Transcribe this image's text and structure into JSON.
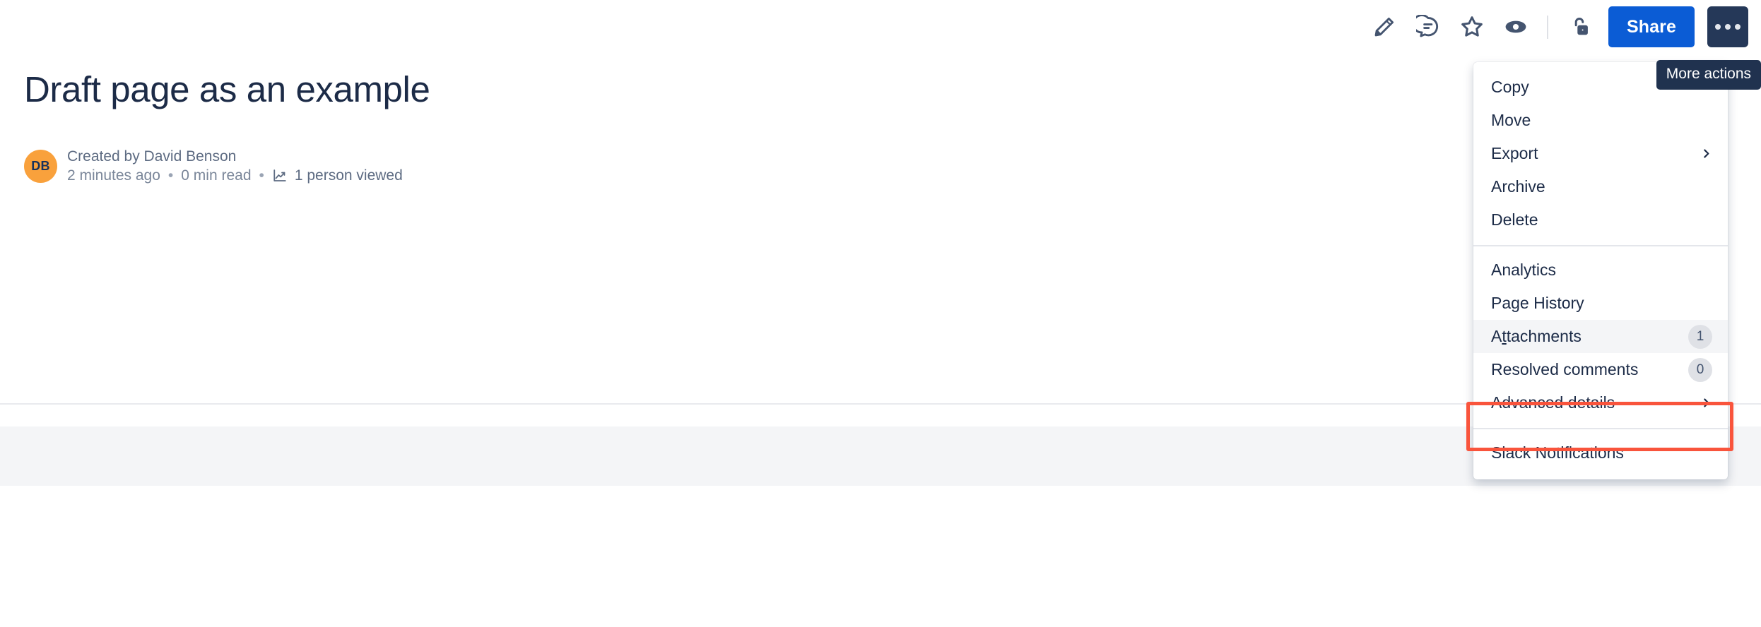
{
  "toolbar": {
    "icons": [
      {
        "name": "edit-pencil-icon",
        "label": "Edit"
      },
      {
        "name": "comment-icon",
        "label": "Comment"
      },
      {
        "name": "star-icon",
        "label": "Star"
      },
      {
        "name": "watch-eye-icon",
        "label": "Watch"
      }
    ],
    "restrictions_icon": "unlocked-padlock-icon",
    "share_label": "Share",
    "more_actions_name": "more-actions-icon",
    "tooltip": "More actions"
  },
  "page": {
    "title": "Draft page as an example",
    "avatar_initials": "DB",
    "created_by": "Created by David Benson",
    "time_ago": "2 minutes ago",
    "separator": "•",
    "read_time": "0 min read",
    "analytics_icon": "line-chart-icon",
    "views": "1 person viewed"
  },
  "menu": {
    "groups": [
      {
        "items": [
          {
            "label": "Copy",
            "name": "menu-item-copy",
            "badge": null,
            "chevron": false,
            "highlighted": false
          },
          {
            "label": "Move",
            "name": "menu-item-move",
            "badge": null,
            "chevron": false,
            "highlighted": false
          },
          {
            "label": "Export",
            "name": "menu-item-export",
            "badge": null,
            "chevron": true,
            "highlighted": false
          },
          {
            "label": "Archive",
            "name": "menu-item-archive",
            "badge": null,
            "chevron": false,
            "highlighted": false
          },
          {
            "label": "Delete",
            "name": "menu-item-delete",
            "badge": null,
            "chevron": false,
            "highlighted": false
          }
        ]
      },
      {
        "items": [
          {
            "label": "Analytics",
            "name": "menu-item-analytics",
            "badge": null,
            "chevron": false,
            "highlighted": false
          },
          {
            "label": "Page History",
            "name": "menu-item-page-history",
            "badge": null,
            "chevron": false,
            "highlighted": false
          },
          {
            "label": "Attachments",
            "name": "menu-item-attachments",
            "badge": "1",
            "chevron": false,
            "highlighted": true,
            "accesskey_index": 1
          },
          {
            "label": "Resolved comments",
            "name": "menu-item-resolved-comments",
            "badge": "0",
            "chevron": false,
            "highlighted": false
          },
          {
            "label": "Advanced details",
            "name": "menu-item-advanced-details",
            "badge": null,
            "chevron": true,
            "highlighted": false
          }
        ]
      },
      {
        "items": [
          {
            "label": "Slack Notifications",
            "name": "menu-item-slack-notifications",
            "badge": null,
            "chevron": false,
            "highlighted": false
          }
        ]
      }
    ]
  },
  "annotation": {
    "target": "Attachments",
    "color": "#F9543C"
  },
  "colors": {
    "share_blue": "#0B5CD5",
    "dark_navy": "#253858",
    "avatar_orange": "#F9A13C",
    "text_primary": "#1C2B47",
    "text_muted": "#5D6B82",
    "band_gray": "#F4F5F7",
    "highlight_red": "#F9543C"
  }
}
